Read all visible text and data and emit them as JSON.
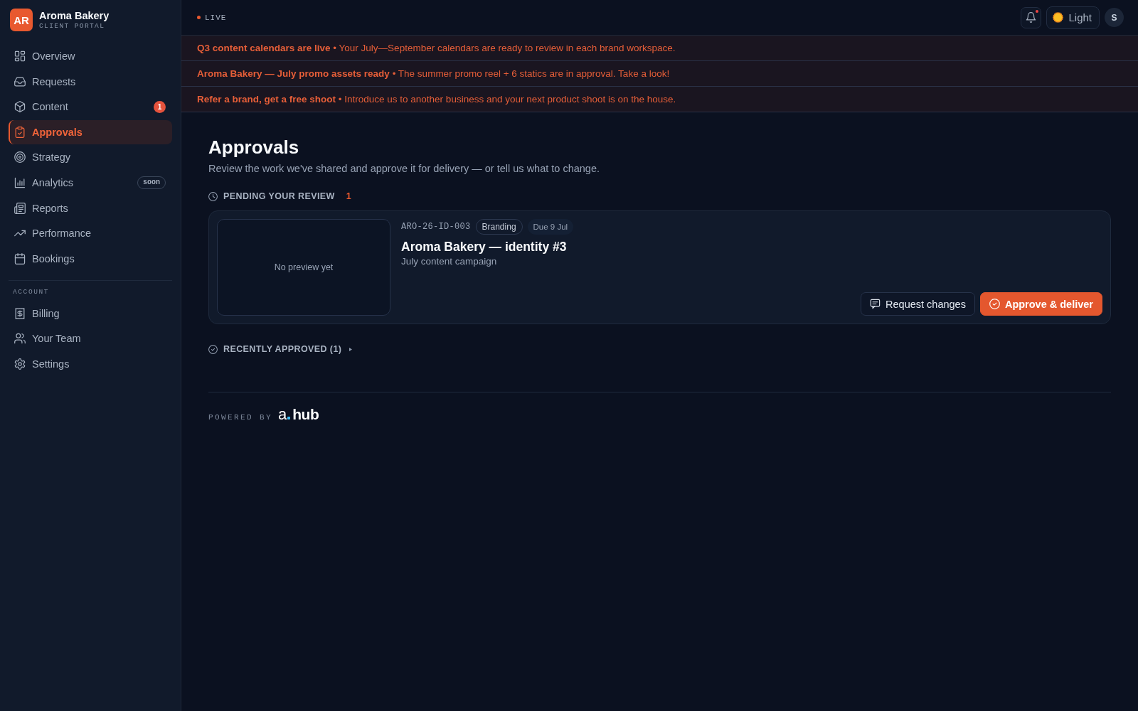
{
  "brand": {
    "initials": "AR",
    "name": "Aroma Bakery",
    "subtitle": "CLIENT PORTAL"
  },
  "sidebar": {
    "sections": [
      {
        "items": [
          {
            "label": "Overview",
            "selected": false
          },
          {
            "label": "Requests",
            "selected": false
          },
          {
            "label": "Content",
            "selected": false,
            "badge": {
              "kind": "count",
              "text": "1"
            }
          },
          {
            "label": "Approvals",
            "selected": true
          },
          {
            "label": "Strategy",
            "selected": false
          },
          {
            "label": "Analytics",
            "selected": false,
            "badge": {
              "kind": "tag",
              "text": "soon"
            }
          },
          {
            "label": "Reports",
            "selected": false
          },
          {
            "label": "Performance",
            "selected": false
          },
          {
            "label": "Bookings",
            "selected": false
          }
        ]
      },
      {
        "heading": "ACCOUNT",
        "items": [
          {
            "label": "Billing",
            "selected": false
          },
          {
            "label": "Your Team",
            "selected": false
          },
          {
            "label": "Settings",
            "selected": false
          }
        ]
      }
    ]
  },
  "topbar": {
    "status": "LIVE",
    "notifications": {
      "unread": true
    },
    "theme_toggle": "Light",
    "avatar": "S"
  },
  "announcements": [
    "**Q3 content calendars are live** • Your July—September calendars are ready to review in each brand workspace.",
    "**Aroma Bakery — July promo assets ready** • The summer promo reel + 6 statics are in approval. Take a look!",
    "**Refer a brand, get a free shoot** • Introduce us to another business and your next product shoot is on the house."
  ],
  "page": {
    "title": "Approvals",
    "subtitle": "Review the work we've shared and approve it for delivery — or tell us what to change."
  },
  "pending": {
    "title": "PENDING YOUR REVIEW",
    "count": "1",
    "items": [
      {
        "preview": "No preview yet",
        "code": "ARO-26-ID-003",
        "tag": "Branding",
        "due": "Due 9 Jul",
        "title": "Aroma Bakery — identity #3",
        "subtitle": "July content campaign",
        "actions": [
          {
            "kind": "secondary",
            "label": "Request changes"
          },
          {
            "kind": "primary",
            "label": "Approve & deliver"
          }
        ]
      }
    ]
  },
  "recently_approved": {
    "title": "RECENTLY APPROVED (1)",
    "expanded": false
  },
  "footer": {
    "label": "POWERED BY",
    "logo_mark": "a",
    "logo_text": "hub"
  }
}
